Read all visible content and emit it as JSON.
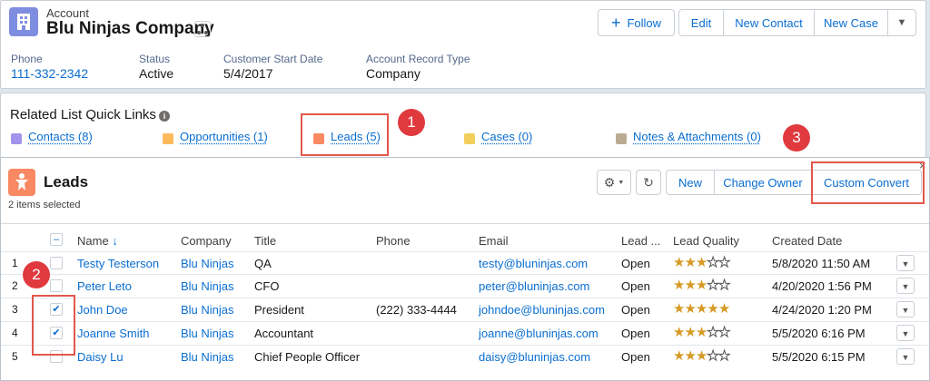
{
  "header": {
    "object_label": "Account",
    "name": "Blu Ninjas Company",
    "buttons": {
      "follow": "Follow",
      "edit": "Edit",
      "new_contact": "New Contact",
      "new_case": "New Case"
    },
    "fields": [
      {
        "label": "Phone",
        "value": "111-332-2342"
      },
      {
        "label": "Status",
        "value": "Active"
      },
      {
        "label": "Customer Start Date",
        "value": "5/4/2017"
      },
      {
        "label": "Account Record Type",
        "value": "Company"
      }
    ]
  },
  "quick_links": {
    "title": "Related List Quick Links",
    "links": [
      {
        "label": "Contacts (8)",
        "color": "#a094ed"
      },
      {
        "label": "Opportunities (1)",
        "color": "#fcb95b"
      },
      {
        "label": "Leads (5)",
        "color": "#f88962"
      },
      {
        "label": "Cases (0)",
        "color": "#f2cf5b"
      },
      {
        "label": "Notes & Attachments (0)",
        "color": "#baac93"
      }
    ]
  },
  "leads": {
    "title": "Leads",
    "selected_text": "2 items selected",
    "buttons": {
      "new": "New",
      "change_owner": "Change Owner",
      "custom_convert": "Custom Convert"
    },
    "columns": [
      "Name",
      "Company",
      "Title",
      "Phone",
      "Email",
      "Lead ...",
      "Lead Quality",
      "Created Date"
    ],
    "rows": [
      {
        "num": "1",
        "name": "Testy Testerson",
        "company": "Blu Ninjas",
        "title": "QA",
        "phone": "",
        "email": "testy@bluninjas.com",
        "status": "Open",
        "quality": 3,
        "created": "5/8/2020 11:50 AM",
        "checked": false
      },
      {
        "num": "2",
        "name": "Peter Leto",
        "company": "Blu Ninjas",
        "title": "CFO",
        "phone": "",
        "email": "peter@bluninjas.com",
        "status": "Open",
        "quality": 3,
        "created": "4/20/2020 1:56 PM",
        "checked": false
      },
      {
        "num": "3",
        "name": "John Doe",
        "company": "Blu Ninjas",
        "title": "President",
        "phone": "(222) 333-4444",
        "email": "johndoe@bluninjas.com",
        "status": "Open",
        "quality": 5,
        "created": "4/24/2020 1:20 PM",
        "checked": true
      },
      {
        "num": "4",
        "name": "Joanne Smith",
        "company": "Blu Ninjas",
        "title": "Accountant",
        "phone": "",
        "email": "joanne@bluninjas.com",
        "status": "Open",
        "quality": 3,
        "created": "5/5/2020 6:16 PM",
        "checked": true
      },
      {
        "num": "5",
        "name": "Daisy Lu",
        "company": "Blu Ninjas",
        "title": "Chief People Officer",
        "phone": "",
        "email": "daisy@bluninjas.com",
        "status": "Open",
        "quality": 3,
        "created": "5/5/2020 6:15 PM",
        "checked": false
      }
    ]
  },
  "annotations": [
    "1",
    "2",
    "3"
  ]
}
